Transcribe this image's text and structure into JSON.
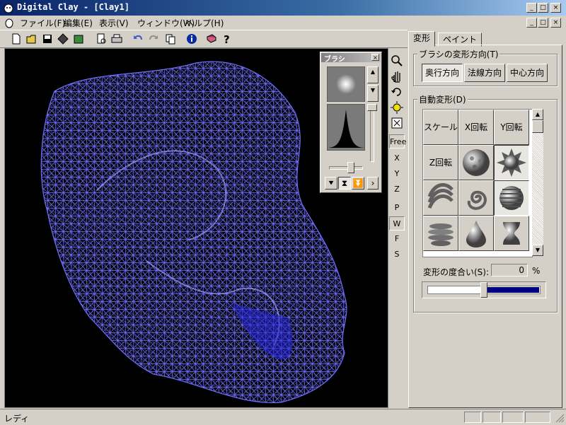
{
  "window": {
    "title": "Digital Clay - [Clay1]",
    "caption_minimize": "_",
    "caption_maximize": "□",
    "caption_close": "×"
  },
  "menu": [
    {
      "label": "ファイル(F)"
    },
    {
      "label": "編集(E)"
    },
    {
      "label": "表示(V)"
    },
    {
      "label": "ウィンドウ(W)"
    },
    {
      "label": "ヘルプ(H)"
    }
  ],
  "brush_palette": {
    "title": "ブラシ",
    "close": "×"
  },
  "tool_strip": [
    "Free",
    "X",
    "Y",
    "Z",
    "P",
    "W",
    "F",
    "S"
  ],
  "panel": {
    "tabs": [
      "変形",
      "ペイント"
    ],
    "brush_direction": {
      "label": "ブラシの変形方向(T)",
      "buttons": [
        "奥行方向",
        "法線方向",
        "中心方向"
      ],
      "selected": "奥行方向"
    },
    "auto_deform": {
      "label": "自動変形(D)",
      "text_cells": [
        "スケール",
        "X回転",
        "Y回転",
        "Z回転"
      ]
    },
    "degree": {
      "label": "変形の度合い(S):",
      "value": "0",
      "unit": "%"
    },
    "slider_value": 0.5
  },
  "status": {
    "text": "レディ"
  },
  "colors": {
    "wire": "#6f6fff",
    "viewport_bg": "#000000",
    "slider_fill": "#000080"
  }
}
